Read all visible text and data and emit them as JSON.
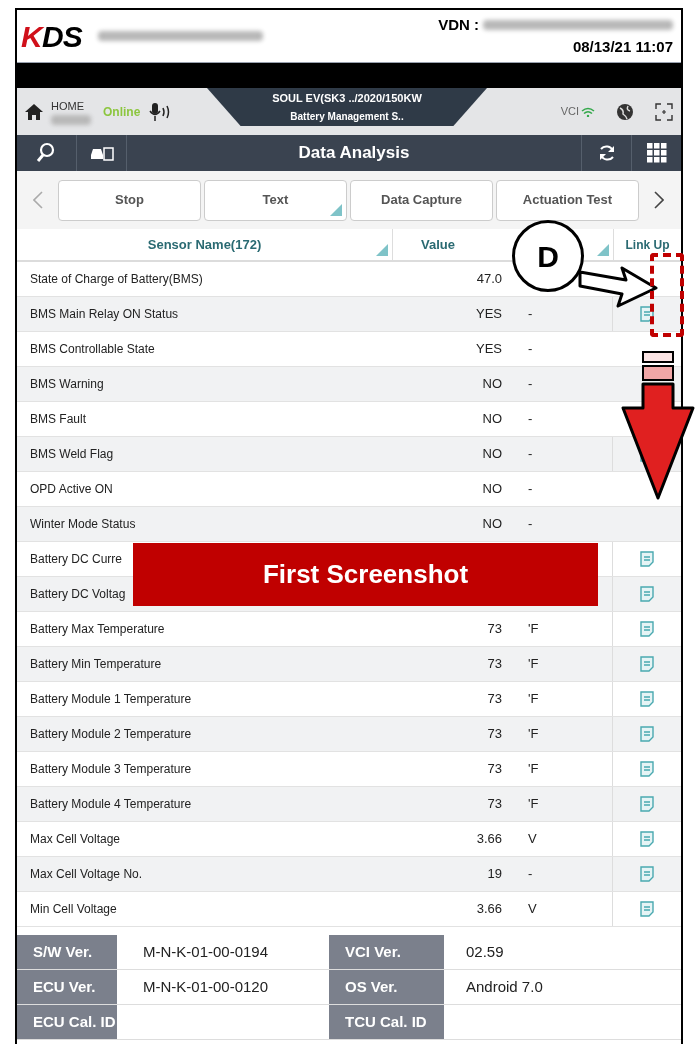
{
  "header": {
    "logo": "KDS",
    "vdn_label": "VDN :",
    "datetime": "08/13/21 11:07"
  },
  "nav": {
    "home": "HOME",
    "status": "Online",
    "vehicle": "SOUL EV(SK3 ../2020/150KW",
    "system": "Battery Management S..",
    "vci": "VCI"
  },
  "title_bar": {
    "title": "Data Analysis"
  },
  "toolbar": [
    {
      "label": "Stop",
      "dropdown": false
    },
    {
      "label": "Text",
      "dropdown": true
    },
    {
      "label": "Data Capture",
      "dropdown": false
    },
    {
      "label": "Actuation Test",
      "dropdown": false
    }
  ],
  "table": {
    "columns": [
      "Sensor Name(172)",
      "Value",
      "Link Up"
    ],
    "rows": [
      {
        "name": "State of Charge of Battery(BMS)",
        "value": "47.0",
        "link": false
      },
      {
        "name": "BMS Main Relay ON Status",
        "value": "YES",
        "unit": "-",
        "link": true
      },
      {
        "name": "BMS Controllable State",
        "value": "YES",
        "unit": "-",
        "link": false
      },
      {
        "name": "BMS Warning",
        "value": "NO",
        "unit": "-",
        "link": false
      },
      {
        "name": "BMS Fault",
        "value": "NO",
        "unit": "-",
        "link": false
      },
      {
        "name": "BMS Weld Flag",
        "value": "NO",
        "unit": "-",
        "link": true
      },
      {
        "name": "OPD Active ON",
        "value": "NO",
        "unit": "-",
        "link": false
      },
      {
        "name": "Winter Mode Status",
        "value": "NO",
        "unit": "-",
        "link": false
      },
      {
        "name": "Battery DC Curre",
        "link": true
      },
      {
        "name": "Battery DC Voltag",
        "link": true
      },
      {
        "name": "Battery Max Temperature",
        "value": "73",
        "unit": "'F",
        "link": true
      },
      {
        "name": "Battery Min Temperature",
        "value": "73",
        "unit": "'F",
        "link": true
      },
      {
        "name": "Battery Module 1 Temperature",
        "value": "73",
        "unit": "'F",
        "link": true
      },
      {
        "name": "Battery Module 2 Temperature",
        "value": "73",
        "unit": "'F",
        "link": true
      },
      {
        "name": "Battery Module 3 Temperature",
        "value": "73",
        "unit": "'F",
        "link": true
      },
      {
        "name": "Battery Module 4 Temperature",
        "value": "73",
        "unit": "'F",
        "link": true
      },
      {
        "name": "Max Cell Voltage",
        "value": "3.66",
        "unit": "V",
        "link": true
      },
      {
        "name": "Max Cell Voltage No.",
        "value": "19",
        "unit": "-",
        "link": true
      },
      {
        "name": "Min Cell Voltage",
        "value": "3.66",
        "unit": "V",
        "link": true
      }
    ]
  },
  "info": [
    {
      "label": "S/W Ver.",
      "value": "M-N-K-01-00-0194",
      "label_2": "VCI Ver.",
      "value_2": "02.59"
    },
    {
      "label": "ECU Ver.",
      "value": "M-N-K-01-00-0120",
      "label_2": "OS Ver.",
      "value_2": "Android 7.0"
    },
    {
      "label": "ECU Cal. ID",
      "label_2": "TCU Cal. ID"
    }
  ],
  "annotations": {
    "callout": "D",
    "banner": "First Screenshot"
  }
}
